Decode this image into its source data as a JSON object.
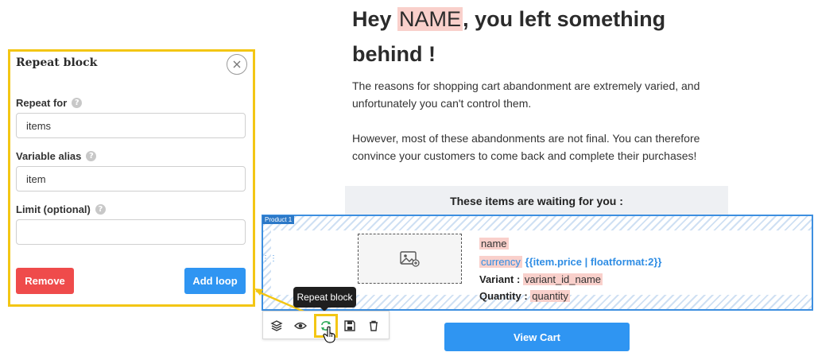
{
  "panel": {
    "title": "Repeat block",
    "repeat_for_label": "Repeat for",
    "repeat_for_value": "items",
    "variable_alias_label": "Variable alias",
    "variable_alias_value": "item",
    "limit_label": "Limit (optional)",
    "limit_value": "",
    "remove_label": "Remove",
    "add_loop_label": "Add loop",
    "help_glyph": "?"
  },
  "email": {
    "headline_pre": "Hey ",
    "headline_var": "NAME",
    "headline_post": ", you left something behind !",
    "para1": "The reasons for shopping cart abandonment are extremely varied, and unfortunately you can't control them.",
    "para2": "However, most of these abandonments are not final. You can therefore convince your customers to come back and complete their purchases!",
    "waiting_title": "These items are waiting for you :",
    "view_cart_label": "View Cart"
  },
  "product": {
    "tag": "Product 1",
    "name": "name",
    "currency": "currency",
    "price_expr": "{{item.price | floatformat:2}}",
    "variant_label": "Variant :",
    "variant_value": "variant_id_name",
    "quantity_label": "Quantity :",
    "quantity_value": "quantity"
  },
  "toolbar": {
    "tooltip": "Repeat block",
    "icons": [
      "layers-icon",
      "eye-icon",
      "repeat-icon",
      "save-icon",
      "trash-icon"
    ]
  },
  "colors": {
    "highlight_yellow": "#f3c614",
    "accent_blue": "#2f95f2",
    "danger_red": "#ef4b4b",
    "variable_pink": "#f9d0cb",
    "block_border_blue": "#3d8fe0"
  }
}
